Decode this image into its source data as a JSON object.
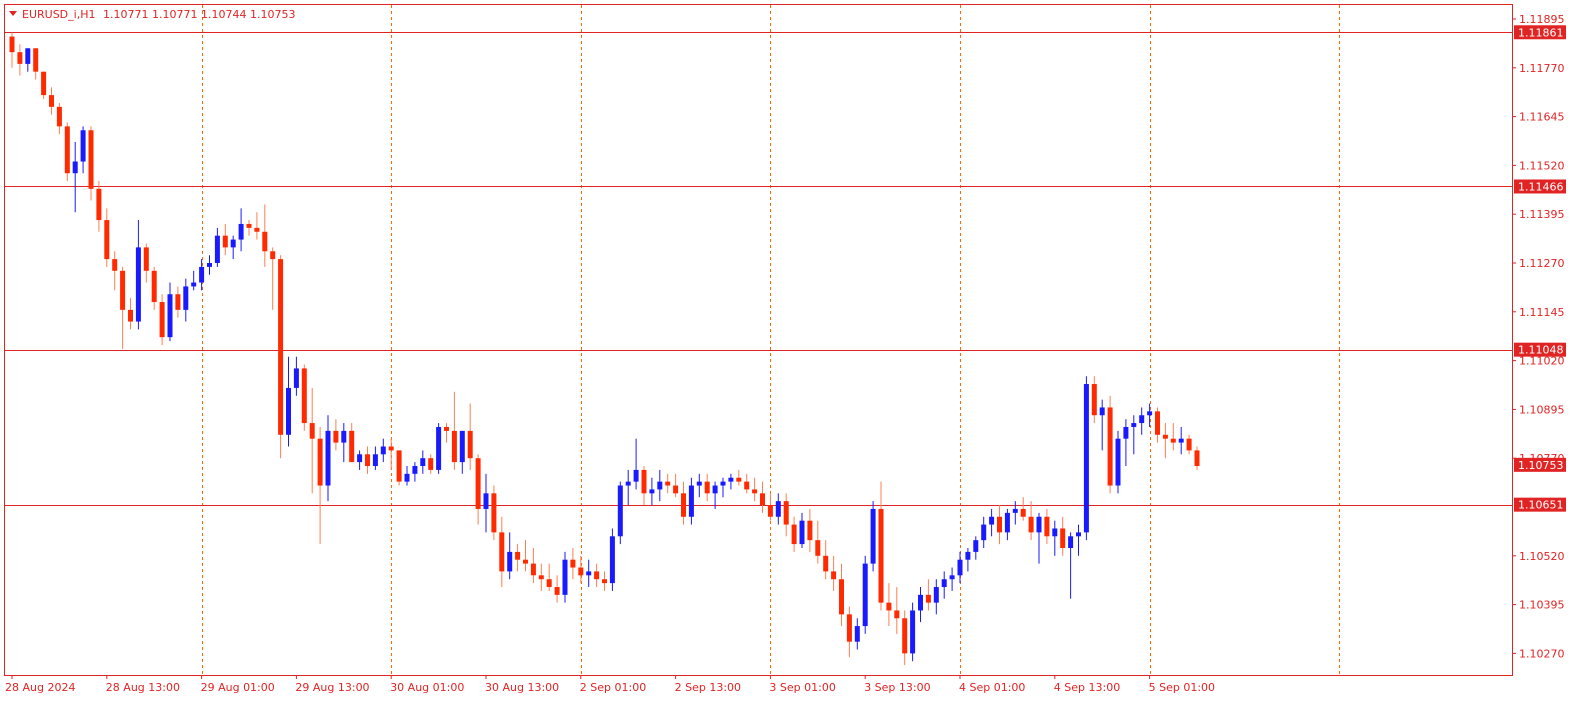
{
  "header": {
    "symbol": "EURUSD_i,H1",
    "ohlc": "1.10771 1.10771 1.10744 1.10753"
  },
  "colors": {
    "background": "#ffffff",
    "frame": "#e02424",
    "bull": "#1a1aff",
    "bear": "#ff2a00",
    "wick_bear": "#ff7f50",
    "grid": "#ff6a00",
    "level_line": "#e02424"
  },
  "chart_data": {
    "type": "candlestick",
    "timeframe": "H1",
    "ylim": [
      1.1021,
      1.1193
    ],
    "y_ticks": [
      "1.11895",
      "1.11770",
      "1.11645",
      "1.11520",
      "1.11395",
      "1.11270",
      "1.11145",
      "1.11020",
      "1.10895",
      "1.10770",
      "1.10520",
      "1.10395",
      "1.10270"
    ],
    "x_ticks": [
      "28 Aug 2024",
      "28 Aug 13:00",
      "29 Aug 01:00",
      "29 Aug 13:00",
      "30 Aug 01:00",
      "30 Aug 13:00",
      "2 Sep 01:00",
      "2 Sep 13:00",
      "3 Sep 01:00",
      "3 Sep 13:00",
      "4 Sep 01:00",
      "4 Sep 13:00",
      "5 Sep 01:00"
    ],
    "horizontal_levels": [
      "1.11861",
      "1.11466",
      "1.11048",
      "1.10651"
    ],
    "current_price": "1.10753",
    "vertical_grid": "dashed, every 24 bars",
    "candles": [
      [
        1.1185,
        1.1186,
        1.1177,
        1.1181
      ],
      [
        1.1181,
        1.1183,
        1.1175,
        1.1178
      ],
      [
        1.1178,
        1.1182,
        1.1176,
        1.1182
      ],
      [
        1.1182,
        1.1182,
        1.1174,
        1.1176
      ],
      [
        1.1176,
        1.1176,
        1.1169,
        1.117
      ],
      [
        1.117,
        1.1172,
        1.1165,
        1.1167
      ],
      [
        1.1167,
        1.1168,
        1.116,
        1.1162
      ],
      [
        1.1162,
        1.1163,
        1.1148,
        1.115
      ],
      [
        1.115,
        1.1158,
        1.114,
        1.1153
      ],
      [
        1.1153,
        1.1162,
        1.115,
        1.1161
      ],
      [
        1.1161,
        1.1162,
        1.1143,
        1.1146
      ],
      [
        1.1146,
        1.1148,
        1.1135,
        1.1138
      ],
      [
        1.1138,
        1.1141,
        1.1126,
        1.1128
      ],
      [
        1.1128,
        1.113,
        1.112,
        1.1125
      ],
      [
        1.1125,
        1.1126,
        1.1105,
        1.1115
      ],
      [
        1.1115,
        1.1118,
        1.111,
        1.1112
      ],
      [
        1.1112,
        1.1138,
        1.111,
        1.1131
      ],
      [
        1.1131,
        1.1132,
        1.1122,
        1.1125
      ],
      [
        1.1125,
        1.1126,
        1.1115,
        1.1117
      ],
      [
        1.1117,
        1.1119,
        1.1106,
        1.1108
      ],
      [
        1.1108,
        1.1122,
        1.1107,
        1.1119
      ],
      [
        1.1119,
        1.1121,
        1.1113,
        1.1115
      ],
      [
        1.1115,
        1.1123,
        1.1112,
        1.1121
      ],
      [
        1.1121,
        1.1125,
        1.112,
        1.1122
      ],
      [
        1.1122,
        1.1128,
        1.112,
        1.1126
      ],
      [
        1.1126,
        1.1129,
        1.1124,
        1.1127
      ],
      [
        1.1127,
        1.1136,
        1.1126,
        1.1134
      ],
      [
        1.1134,
        1.1137,
        1.1129,
        1.1131
      ],
      [
        1.1131,
        1.1134,
        1.1128,
        1.1133
      ],
      [
        1.1133,
        1.1141,
        1.113,
        1.1137
      ],
      [
        1.1137,
        1.1138,
        1.1134,
        1.1136
      ],
      [
        1.1136,
        1.114,
        1.1133,
        1.1135
      ],
      [
        1.1135,
        1.1142,
        1.1126,
        1.113
      ],
      [
        1.113,
        1.1131,
        1.1115,
        1.1128
      ],
      [
        1.1128,
        1.1129,
        1.1077,
        1.1083
      ],
      [
        1.1083,
        1.1103,
        1.108,
        1.1095
      ],
      [
        1.1095,
        1.1103,
        1.1093,
        1.11
      ],
      [
        1.11,
        1.1101,
        1.1084,
        1.1086
      ],
      [
        1.1086,
        1.1095,
        1.1068,
        1.1082
      ],
      [
        1.1082,
        1.1085,
        1.1055,
        1.107
      ],
      [
        1.107,
        1.1088,
        1.1066,
        1.1084
      ],
      [
        1.1084,
        1.1087,
        1.1079,
        1.1081
      ],
      [
        1.1081,
        1.1086,
        1.1076,
        1.1084
      ],
      [
        1.1084,
        1.1086,
        1.1077,
        1.1076
      ],
      [
        1.1076,
        1.1079,
        1.1074,
        1.1078
      ],
      [
        1.1078,
        1.108,
        1.1073,
        1.1075
      ],
      [
        1.1075,
        1.108,
        1.1074,
        1.1078
      ],
      [
        1.1078,
        1.1082,
        1.1076,
        1.108
      ],
      [
        1.108,
        1.1082,
        1.1074,
        1.1079
      ],
      [
        1.1079,
        1.1079,
        1.107,
        1.1071
      ],
      [
        1.1071,
        1.1075,
        1.107,
        1.1073
      ],
      [
        1.1073,
        1.1076,
        1.1071,
        1.1075
      ],
      [
        1.1075,
        1.1079,
        1.1073,
        1.1077
      ],
      [
        1.1077,
        1.1078,
        1.1073,
        1.1074
      ],
      [
        1.1074,
        1.1086,
        1.1073,
        1.1085
      ],
      [
        1.1085,
        1.1086,
        1.1081,
        1.1084
      ],
      [
        1.1084,
        1.1094,
        1.1074,
        1.1076
      ],
      [
        1.1076,
        1.1081,
        1.1073,
        1.1084
      ],
      [
        1.1084,
        1.1091,
        1.1074,
        1.1077
      ],
      [
        1.1077,
        1.1078,
        1.106,
        1.1064
      ],
      [
        1.1064,
        1.1073,
        1.1058,
        1.1068
      ],
      [
        1.1068,
        1.107,
        1.1056,
        1.1058
      ],
      [
        1.1058,
        1.1062,
        1.1044,
        1.1048
      ],
      [
        1.1048,
        1.1058,
        1.1046,
        1.1053
      ],
      [
        1.1053,
        1.1055,
        1.1048,
        1.1051
      ],
      [
        1.1051,
        1.1056,
        1.1048,
        1.105
      ],
      [
        1.105,
        1.1054,
        1.1045,
        1.1047
      ],
      [
        1.1047,
        1.105,
        1.1043,
        1.1046
      ],
      [
        1.1046,
        1.105,
        1.1043,
        1.1044
      ],
      [
        1.1044,
        1.1047,
        1.104,
        1.1042
      ],
      [
        1.1042,
        1.1053,
        1.104,
        1.1051
      ],
      [
        1.1051,
        1.1054,
        1.1046,
        1.1049
      ],
      [
        1.1049,
        1.1052,
        1.1045,
        1.1047
      ],
      [
        1.1047,
        1.1051,
        1.1044,
        1.1048
      ],
      [
        1.1048,
        1.105,
        1.1044,
        1.1046
      ],
      [
        1.1046,
        1.1048,
        1.1043,
        1.1045
      ],
      [
        1.1045,
        1.1059,
        1.1043,
        1.1057
      ],
      [
        1.1057,
        1.1071,
        1.1055,
        1.107
      ],
      [
        1.107,
        1.1074,
        1.1065,
        1.1071
      ],
      [
        1.1071,
        1.1082,
        1.1069,
        1.1074
      ],
      [
        1.1074,
        1.1075,
        1.1065,
        1.1068
      ],
      [
        1.1068,
        1.1072,
        1.1065,
        1.1069
      ],
      [
        1.1069,
        1.1074,
        1.1066,
        1.1071
      ],
      [
        1.1071,
        1.1073,
        1.1068,
        1.107
      ],
      [
        1.107,
        1.1073,
        1.1067,
        1.1068
      ],
      [
        1.1068,
        1.1071,
        1.106,
        1.1062
      ],
      [
        1.1062,
        1.1072,
        1.106,
        1.107
      ],
      [
        1.107,
        1.1073,
        1.1067,
        1.1071
      ],
      [
        1.1071,
        1.1073,
        1.1066,
        1.1068
      ],
      [
        1.1068,
        1.1071,
        1.1064,
        1.107
      ],
      [
        1.107,
        1.1072,
        1.1067,
        1.1071
      ],
      [
        1.1071,
        1.1073,
        1.1069,
        1.1072
      ],
      [
        1.1072,
        1.1074,
        1.107,
        1.1071
      ],
      [
        1.1071,
        1.1073,
        1.1068,
        1.1069
      ],
      [
        1.1069,
        1.1072,
        1.1066,
        1.1068
      ],
      [
        1.1068,
        1.1071,
        1.1063,
        1.1065
      ],
      [
        1.1065,
        1.1068,
        1.1061,
        1.1062
      ],
      [
        1.1062,
        1.1068,
        1.106,
        1.1066
      ],
      [
        1.1066,
        1.1068,
        1.1057,
        1.106
      ],
      [
        1.106,
        1.1062,
        1.1053,
        1.1055
      ],
      [
        1.1055,
        1.1063,
        1.1054,
        1.1061
      ],
      [
        1.1061,
        1.1064,
        1.1053,
        1.1056
      ],
      [
        1.1056,
        1.1061,
        1.105,
        1.1052
      ],
      [
        1.1052,
        1.1056,
        1.1046,
        1.1048
      ],
      [
        1.1048,
        1.1052,
        1.1043,
        1.1046
      ],
      [
        1.1046,
        1.105,
        1.1034,
        1.1037
      ],
      [
        1.1037,
        1.1039,
        1.1026,
        1.103
      ],
      [
        1.103,
        1.1036,
        1.1028,
        1.1034
      ],
      [
        1.1034,
        1.1052,
        1.1032,
        1.105
      ],
      [
        1.105,
        1.1066,
        1.1048,
        1.1064
      ],
      [
        1.1064,
        1.1071,
        1.1038,
        1.104
      ],
      [
        1.104,
        1.1045,
        1.1034,
        1.1038
      ],
      [
        1.1038,
        1.1044,
        1.1032,
        1.1036
      ],
      [
        1.1036,
        1.1038,
        1.1024,
        1.1027
      ],
      [
        1.1027,
        1.104,
        1.1025,
        1.1038
      ],
      [
        1.1038,
        1.1044,
        1.1035,
        1.1042
      ],
      [
        1.1042,
        1.1046,
        1.1038,
        1.104
      ],
      [
        1.104,
        1.1046,
        1.1037,
        1.1044
      ],
      [
        1.1044,
        1.1048,
        1.1041,
        1.1046
      ],
      [
        1.1046,
        1.1049,
        1.1043,
        1.1047
      ],
      [
        1.1047,
        1.1053,
        1.1045,
        1.1051
      ],
      [
        1.1051,
        1.1054,
        1.1048,
        1.1053
      ],
      [
        1.1053,
        1.1057,
        1.1051,
        1.1056
      ],
      [
        1.1056,
        1.1062,
        1.1054,
        1.106
      ],
      [
        1.106,
        1.1064,
        1.1057,
        1.1062
      ],
      [
        1.1062,
        1.1065,
        1.1055,
        1.1058
      ],
      [
        1.1058,
        1.1064,
        1.1056,
        1.1063
      ],
      [
        1.1063,
        1.1066,
        1.106,
        1.1064
      ],
      [
        1.1064,
        1.1067,
        1.1061,
        1.1062
      ],
      [
        1.1062,
        1.1066,
        1.1056,
        1.1058
      ],
      [
        1.1058,
        1.1063,
        1.105,
        1.1062
      ],
      [
        1.1062,
        1.1064,
        1.1055,
        1.1057
      ],
      [
        1.1057,
        1.1061,
        1.1052,
        1.1059
      ],
      [
        1.1059,
        1.1062,
        1.1052,
        1.1054
      ],
      [
        1.1054,
        1.1058,
        1.1041,
        1.1057
      ],
      [
        1.1057,
        1.106,
        1.1052,
        1.1058
      ],
      [
        1.1058,
        1.1098,
        1.1056,
        1.1096
      ],
      [
        1.1096,
        1.1098,
        1.1086,
        1.1088
      ],
      [
        1.1088,
        1.1092,
        1.1079,
        1.109
      ],
      [
        1.109,
        1.1093,
        1.1068,
        1.107
      ],
      [
        1.107,
        1.1084,
        1.1068,
        1.1082
      ],
      [
        1.1082,
        1.1087,
        1.1075,
        1.1085
      ],
      [
        1.1085,
        1.1088,
        1.1078,
        1.1086
      ],
      [
        1.1086,
        1.109,
        1.1083,
        1.1088
      ],
      [
        1.1088,
        1.1091,
        1.1085,
        1.1089
      ],
      [
        1.1089,
        1.109,
        1.1081,
        1.1083
      ],
      [
        1.1083,
        1.1086,
        1.1077,
        1.1082
      ],
      [
        1.1082,
        1.1086,
        1.1079,
        1.1081
      ],
      [
        1.1081,
        1.1085,
        1.1078,
        1.1082
      ],
      [
        1.1082,
        1.1083,
        1.1078,
        1.1079
      ],
      [
        1.1079,
        1.108,
        1.1074,
        1.1075
      ]
    ]
  }
}
